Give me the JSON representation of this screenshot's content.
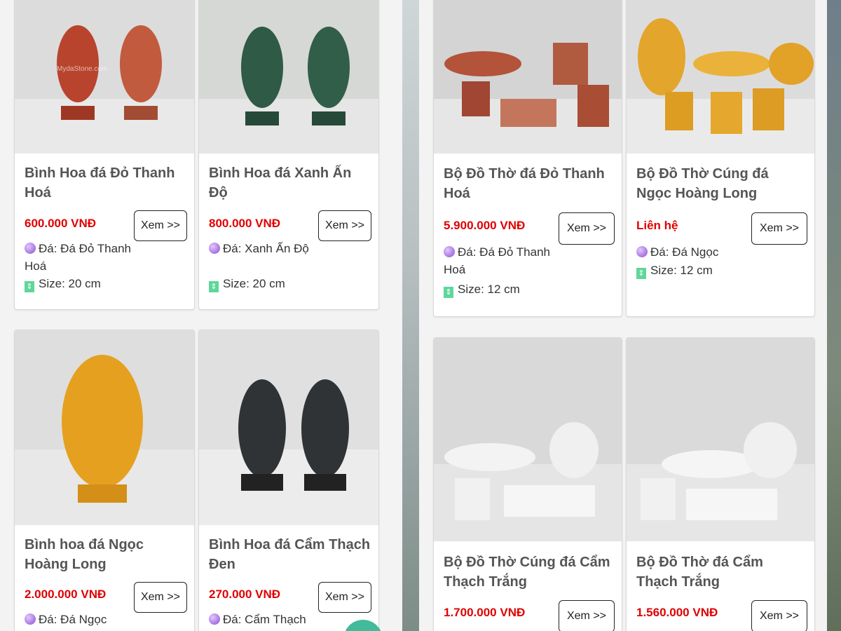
{
  "left_products": [
    {
      "title": "Bình Hoa đá Đỏ Thanh Hoá",
      "price": "600.000 VNĐ",
      "button": "Xem >>",
      "stone": "Đá: Đá Đỏ Thanh Hoá",
      "size": "Size: 20 cm"
    },
    {
      "title": "Bình Hoa đá Xanh Ấn Độ",
      "price": "800.000 VNĐ",
      "button": "Xem >>",
      "stone": "Đá: Xanh Ấn Độ",
      "size": "Size: 20 cm"
    },
    {
      "title": "Bình hoa đá Ngọc Hoàng Long",
      "price": "2.000.000 VNĐ",
      "button": "Xem >>",
      "stone": "Đá: Đá Ngọc",
      "size": ""
    },
    {
      "title": "Bình Hoa đá Cẩm Thạch Đen",
      "price": "270.000 VNĐ",
      "button": "Xem >>",
      "stone": "Đá: Cẩm Thạch",
      "size": ""
    }
  ],
  "right_products": [
    {
      "title": "Bộ Đồ Thờ đá Đỏ Thanh Hoá",
      "price": "5.900.000 VNĐ",
      "button": "Xem >>",
      "stone": "Đá: Đá Đỏ Thanh Hoá",
      "size": "Size: 12 cm"
    },
    {
      "title": "Bộ Đồ Thờ Cúng đá Ngọc Hoàng Long",
      "price": "Liên hệ",
      "button": "Xem >>",
      "stone": "Đá: Đá Ngọc",
      "size": "Size: 12 cm"
    },
    {
      "title": "Bộ Đồ Thờ Cúng đá Cẩm Thạch Trắng",
      "price": "1.700.000 VNĐ",
      "button": "Xem >>",
      "stone": "",
      "size": ""
    },
    {
      "title": "Bộ Đồ Thờ đá Cẩm Thạch Trắng",
      "price": "1.560.000 VNĐ",
      "button": "Xem >>",
      "stone": "",
      "size": ""
    }
  ],
  "watermark": "MydaStone.com",
  "colors": {
    "price": "#e00000",
    "title": "#555555",
    "card_bg": "#ffffff",
    "page_bg": "#f3f3f3",
    "fab": "#2fb38f"
  },
  "icons": {
    "stone": "gem-icon",
    "size": "ruler-icon"
  }
}
